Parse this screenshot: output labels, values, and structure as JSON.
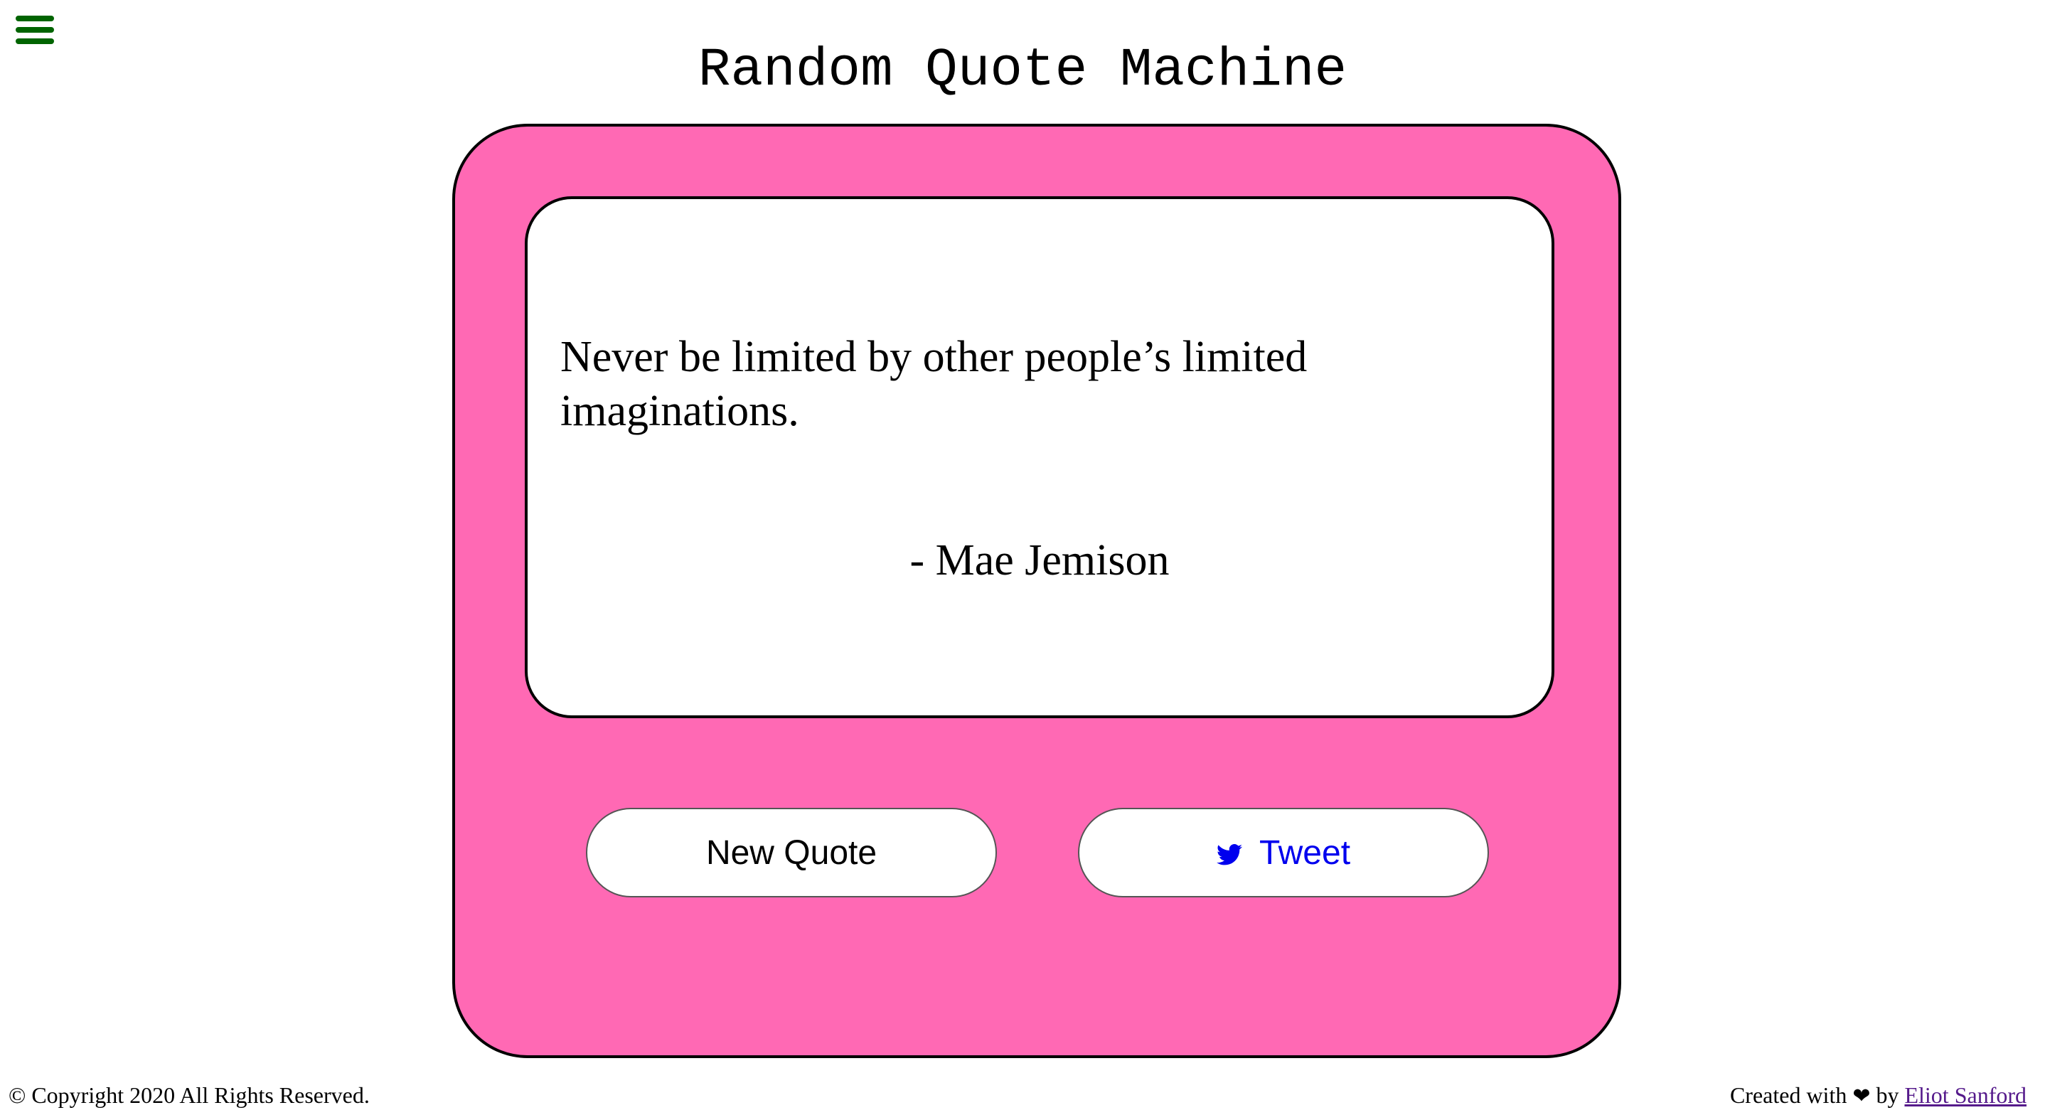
{
  "header": {
    "title": "Random Quote Machine",
    "menu_icon": "hamburger-menu-icon",
    "menu_color": "#006400"
  },
  "quote": {
    "text": "Never be limited by other people’s limited imaginations.",
    "author": "- Mae Jemison"
  },
  "buttons": {
    "new_quote_label": "New Quote",
    "tweet_label": "Tweet",
    "tweet_icon": "twitter-bird-icon"
  },
  "footer": {
    "copyright": "© Copyright 2020 All Rights Reserved.",
    "created_with_prefix": "Created with",
    "heart_symbol": "❤",
    "by_label": "by",
    "author_link": "Eliot Sanford"
  },
  "colors": {
    "box_background": "#ff69b4",
    "card_background": "#ffffff",
    "tweet_text": "#0000ee",
    "link_visited": "#551a8b"
  }
}
